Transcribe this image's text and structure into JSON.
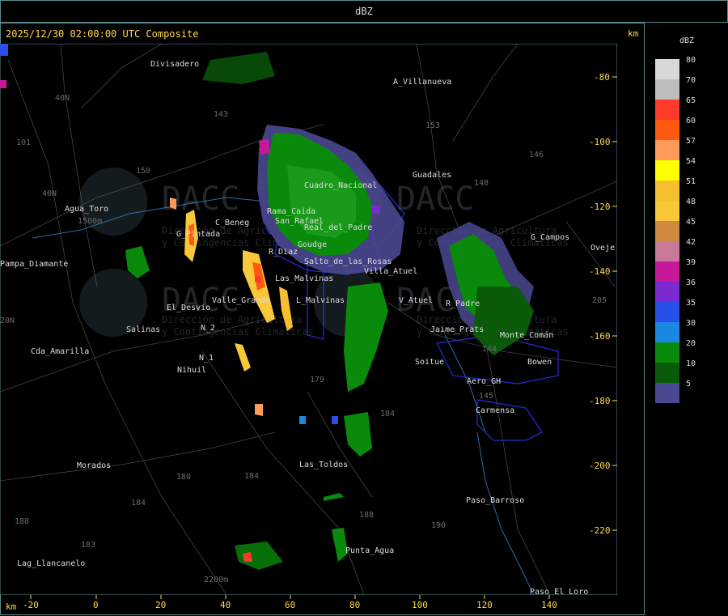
{
  "header": {
    "product": "dBZ",
    "timestamp_line": "2025/12/30 02:00:00 UTC Composite",
    "unit_top": "km",
    "unit_bottom": "km"
  },
  "axes": {
    "x_ticks": [
      "-20",
      "0",
      "20",
      "40",
      "60",
      "80",
      "100",
      "120",
      "140"
    ],
    "y_ticks": [
      "-80",
      "-100",
      "-120",
      "-140",
      "-160",
      "-180",
      "-200",
      "-220"
    ]
  },
  "legend": {
    "unit": "dBZ",
    "entries": [
      {
        "label": "80",
        "color": "#d8d8d8"
      },
      {
        "label": "70",
        "color": "#bdbdbd"
      },
      {
        "label": "65",
        "color": "#ff3a2a"
      },
      {
        "label": "60",
        "color": "#ff5a10"
      },
      {
        "label": "57",
        "color": "#ff9a5a"
      },
      {
        "label": "54",
        "color": "#ffff00"
      },
      {
        "label": "51",
        "color": "#f5c030"
      },
      {
        "label": "48",
        "color": "#f8c838"
      },
      {
        "label": "45",
        "color": "#d08a40"
      },
      {
        "label": "42",
        "color": "#c87898"
      },
      {
        "label": "39",
        "color": "#c8189a"
      },
      {
        "label": "36",
        "color": "#7a2ad0"
      },
      {
        "label": "35",
        "color": "#2850e8"
      },
      {
        "label": "30",
        "color": "#1a88e0"
      },
      {
        "label": "20",
        "color": "#0a8a0a"
      },
      {
        "label": "10",
        "color": "#0a5a0a"
      },
      {
        "label": "5",
        "color": "#4a4890"
      }
    ]
  },
  "places": [
    "Divisadero",
    "A_Villanueva",
    "Guadales",
    "G_Campos",
    "Ovejе",
    "Agua_Toro",
    "Pampa_Diamante",
    "El_Desvio",
    "Salinas",
    "N_2",
    "N_1",
    "Nihuil",
    "Cda_Amarilla",
    "Morados",
    "Las_Toldos",
    "Punta_Agua",
    "Lag_Llancanelo",
    "Carmensa",
    "Paso_Barroso",
    "Paso_El_Loro",
    "Soitue",
    "Aero_GH",
    "V_Atuel",
    "R_Padre",
    "Monte_Comán",
    "G_Pintada",
    "Valle_Grande",
    "C_Beneg",
    "R_Diaz",
    "L_Malvinas",
    "Rama_Caida",
    "Real_del_Padre",
    "Goudge",
    "Salto_de_las_Rosas",
    "Jaime_Prats",
    "Bowen",
    "Las_Malvinas",
    "Cuadro_Nacional",
    "Villa_Atuel",
    "San_Rafael"
  ],
  "overlay_numbers": [
    "40N",
    "40N",
    "101",
    "143",
    "144",
    "145",
    "146",
    "148",
    "150",
    "153",
    "179",
    "180",
    "183",
    "184",
    "184",
    "184",
    "188",
    "190",
    "205",
    "20N",
    "1500m",
    "2200m"
  ],
  "watermark": {
    "brand": "DACC",
    "line1": "Dirección de Agricultura",
    "line2": "y Contingencias Climáticas"
  }
}
